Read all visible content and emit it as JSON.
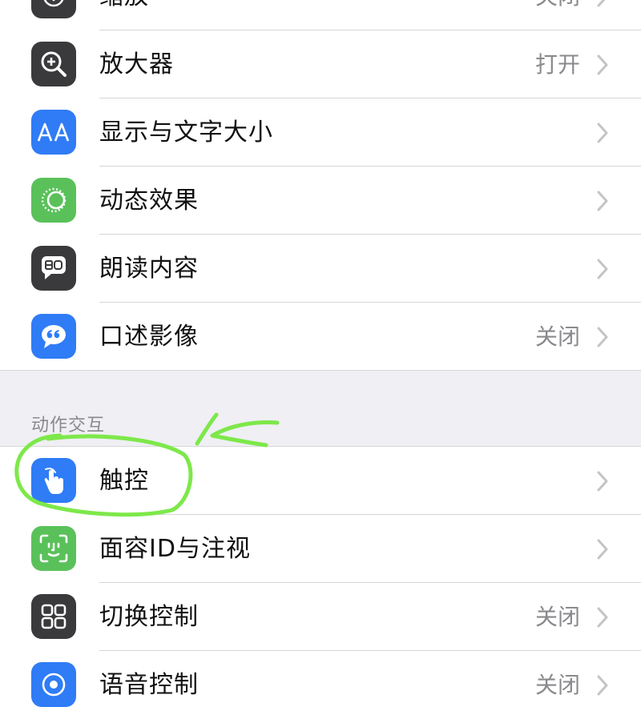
{
  "rows_top": [
    {
      "id": "zoom",
      "label": "缩放",
      "value": "关闭",
      "icon": "zoom-icon",
      "icon_bg": "#3a3a3c"
    },
    {
      "id": "magnifier",
      "label": "放大器",
      "value": "打开",
      "icon": "magnifier-icon",
      "icon_bg": "#3a3a3c"
    },
    {
      "id": "display-text-size",
      "label": "显示与文字大小",
      "value": "",
      "icon": "text-size-icon",
      "icon_bg": "#2f7cf6"
    },
    {
      "id": "motion",
      "label": "动态效果",
      "value": "",
      "icon": "motion-icon",
      "icon_bg": "#5ac15a"
    },
    {
      "id": "spoken-content",
      "label": "朗读内容",
      "value": "",
      "icon": "speech-bubble-icon",
      "icon_bg": "#3a3a3c"
    },
    {
      "id": "audio-descriptions",
      "label": "口述影像",
      "value": "关闭",
      "icon": "quote-bubble-icon",
      "icon_bg": "#2f7cf6"
    }
  ],
  "section": {
    "header": "动作交互"
  },
  "rows_bottom": [
    {
      "id": "touch",
      "label": "触控",
      "value": "",
      "icon": "hand-pointer-icon",
      "icon_bg": "#2f7cf6"
    },
    {
      "id": "face-id-attention",
      "label": "面容ID与注视",
      "value": "",
      "icon": "face-id-icon",
      "icon_bg": "#5ac15a"
    },
    {
      "id": "switch-control",
      "label": "切换控制",
      "value": "关闭",
      "icon": "grid-icon",
      "icon_bg": "#3a3a3c"
    },
    {
      "id": "voice-control",
      "label": "语音控制",
      "value": "关闭",
      "icon": "voice-control-icon",
      "icon_bg": "#2f7cf6"
    }
  ],
  "annotation": {
    "color": "#7de84a"
  }
}
